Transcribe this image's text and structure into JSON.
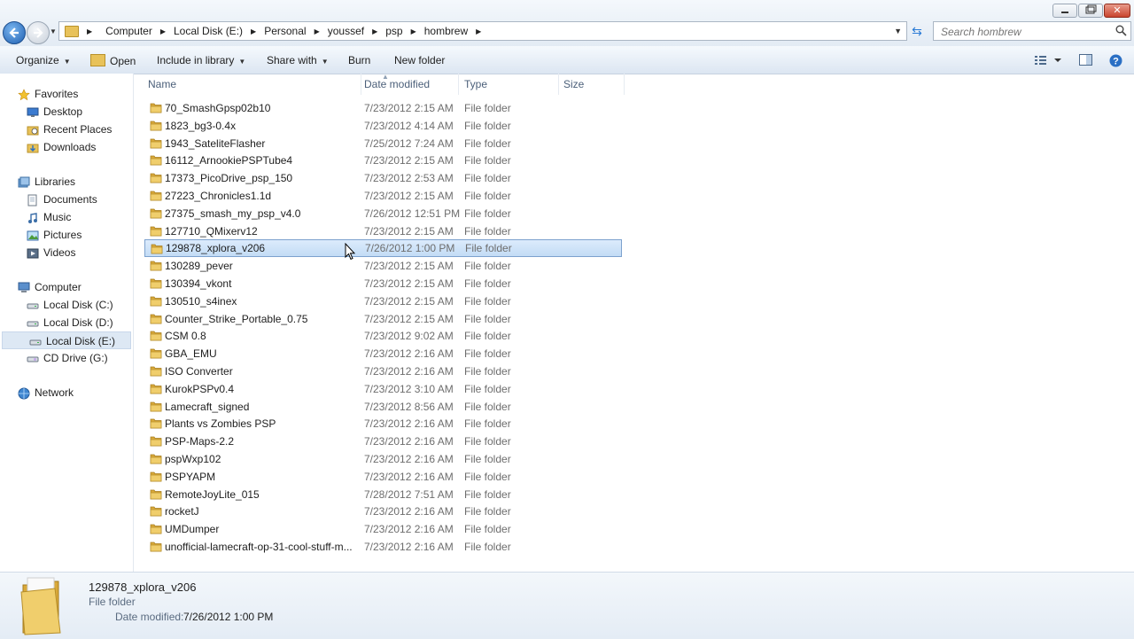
{
  "window": {
    "breadcrumbs": [
      "Computer",
      "Local Disk (E:)",
      "Personal",
      "youssef",
      "psp",
      "hombrew"
    ],
    "search_placeholder": "Search hombrew"
  },
  "toolbar": {
    "organize": "Organize",
    "open": "Open",
    "include_in_library": "Include in library",
    "share_with": "Share with",
    "burn": "Burn",
    "new_folder": "New folder"
  },
  "sidebar": {
    "favorites": {
      "label": "Favorites",
      "items": [
        "Desktop",
        "Recent Places",
        "Downloads"
      ]
    },
    "libraries": {
      "label": "Libraries",
      "items": [
        "Documents",
        "Music",
        "Pictures",
        "Videos"
      ]
    },
    "computer": {
      "label": "Computer",
      "items": [
        "Local Disk (C:)",
        "Local Disk (D:)",
        "Local Disk (E:)",
        "CD Drive (G:)"
      ],
      "selected": "Local Disk (E:)"
    },
    "network": {
      "label": "Network"
    }
  },
  "columns": {
    "name": "Name",
    "date_modified": "Date modified",
    "type": "Type",
    "size": "Size"
  },
  "files": [
    {
      "name": "70_SmashGpsp02b10",
      "date": "7/23/2012 2:15 AM",
      "type": "File folder"
    },
    {
      "name": "1823_bg3-0.4x",
      "date": "7/23/2012 4:14 AM",
      "type": "File folder"
    },
    {
      "name": "1943_SateliteFlasher",
      "date": "7/25/2012 7:24 AM",
      "type": "File folder"
    },
    {
      "name": "16112_ArnookiePSPTube4",
      "date": "7/23/2012 2:15 AM",
      "type": "File folder"
    },
    {
      "name": "17373_PicoDrive_psp_150",
      "date": "7/23/2012 2:53 AM",
      "type": "File folder"
    },
    {
      "name": "27223_Chronicles1.1d",
      "date": "7/23/2012 2:15 AM",
      "type": "File folder"
    },
    {
      "name": "27375_smash_my_psp_v4.0",
      "date": "7/26/2012 12:51 PM",
      "type": "File folder"
    },
    {
      "name": "127710_QMixerv12",
      "date": "7/23/2012 2:15 AM",
      "type": "File folder"
    },
    {
      "name": "129878_xplora_v206",
      "date": "7/26/2012 1:00 PM",
      "type": "File folder",
      "selected": true
    },
    {
      "name": "130289_pever",
      "date": "7/23/2012 2:15 AM",
      "type": "File folder"
    },
    {
      "name": "130394_vkont",
      "date": "7/23/2012 2:15 AM",
      "type": "File folder"
    },
    {
      "name": "130510_s4inex",
      "date": "7/23/2012 2:15 AM",
      "type": "File folder"
    },
    {
      "name": "Counter_Strike_Portable_0.75",
      "date": "7/23/2012 2:15 AM",
      "type": "File folder"
    },
    {
      "name": "CSM 0.8",
      "date": "7/23/2012 9:02 AM",
      "type": "File folder"
    },
    {
      "name": "GBA_EMU",
      "date": "7/23/2012 2:16 AM",
      "type": "File folder"
    },
    {
      "name": "ISO Converter",
      "date": "7/23/2012 2:16 AM",
      "type": "File folder"
    },
    {
      "name": "KurokPSPv0.4",
      "date": "7/23/2012 3:10 AM",
      "type": "File folder"
    },
    {
      "name": "Lamecraft_signed",
      "date": "7/23/2012 8:56 AM",
      "type": "File folder"
    },
    {
      "name": "Plants vs Zombies PSP",
      "date": "7/23/2012 2:16 AM",
      "type": "File folder"
    },
    {
      "name": "PSP-Maps-2.2",
      "date": "7/23/2012 2:16 AM",
      "type": "File folder"
    },
    {
      "name": "pspWxp102",
      "date": "7/23/2012 2:16 AM",
      "type": "File folder"
    },
    {
      "name": "PSPYAPM",
      "date": "7/23/2012 2:16 AM",
      "type": "File folder"
    },
    {
      "name": "RemoteJoyLite_015",
      "date": "7/28/2012 7:51 AM",
      "type": "File folder"
    },
    {
      "name": "rocketJ",
      "date": "7/23/2012 2:16 AM",
      "type": "File folder"
    },
    {
      "name": "UMDumper",
      "date": "7/23/2012 2:16 AM",
      "type": "File folder"
    },
    {
      "name": "unofficial-lamecraft-op-31-cool-stuff-m...",
      "date": "7/23/2012 2:16 AM",
      "type": "File folder"
    }
  ],
  "details": {
    "name": "129878_xplora_v206",
    "type": "File folder",
    "date_modified_label": "Date modified:",
    "date_modified_value": "7/26/2012 1:00 PM"
  },
  "colors": {
    "selection": "#c3dcf5",
    "selection_border": "#7da2ce",
    "folder": "#e8c25a",
    "link_blue": "#1f5fb0"
  }
}
